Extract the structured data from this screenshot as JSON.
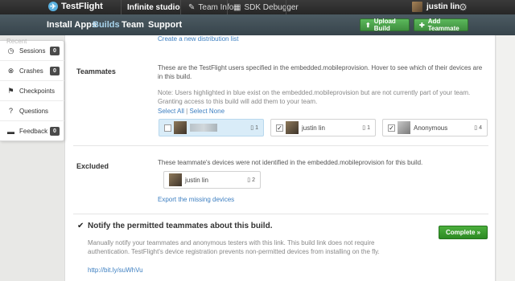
{
  "topbar": {
    "brand": "TestFlight",
    "studio": "Infinite studio",
    "team_info": "Team Info",
    "sdk_debugger": "SDK Debugger",
    "user": "justin lin"
  },
  "nav": {
    "items": [
      "Install Apps",
      "Builds",
      "Team",
      "Support"
    ],
    "active": "Builds",
    "upload_build": "Upload Build",
    "add_teammate": "Add Teammate"
  },
  "sidebar": {
    "ghost": "Recent",
    "items": [
      {
        "label": "Sessions",
        "count": "0",
        "icon": "clock-icon"
      },
      {
        "label": "Crashes",
        "count": "0",
        "icon": "x-circle-icon"
      },
      {
        "label": "Checkpoints",
        "count": "",
        "icon": "flag-icon"
      },
      {
        "label": "Questions",
        "count": "",
        "icon": "question-icon"
      },
      {
        "label": "Feedback",
        "count": "0",
        "icon": "speech-bubble-icon"
      }
    ]
  },
  "distribution": {
    "create_link": "Create a new distribution list"
  },
  "teammates": {
    "title": "Teammates",
    "description": "These are the TestFlight users specified in the embedded.mobileprovision. Hover to see which of their devices are in this build.",
    "note": "Note: Users highlighted in blue exist on the embedded.mobileprovision but are not currently part of your team. Granting access to this build will add them to your team.",
    "select_all": "Select All",
    "select_none": "Select None",
    "people": [
      {
        "name": "",
        "devices": "1",
        "checked": false,
        "highlight": true
      },
      {
        "name": "justin lin",
        "devices": "1",
        "checked": true,
        "highlight": false
      },
      {
        "name": "Anonymous",
        "devices": "4",
        "checked": true,
        "highlight": false
      }
    ]
  },
  "excluded": {
    "title": "Excluded",
    "description": "These teammate's devices were not identified in the embedded.mobileprovision for this build.",
    "person": {
      "name": "justin lin",
      "devices": "2"
    },
    "export_link": "Export the missing devices"
  },
  "notify": {
    "title": "Notify the permitted teammates about this build.",
    "description": "Manually notify your teammates and anonymous testers with this link. This build link does not require authentication. TestFlight's device registration prevents non-permitted devices from installing on the fly.",
    "link": "http://bit.ly/suWhVu",
    "complete_button": "Complete »",
    "checked": true
  }
}
